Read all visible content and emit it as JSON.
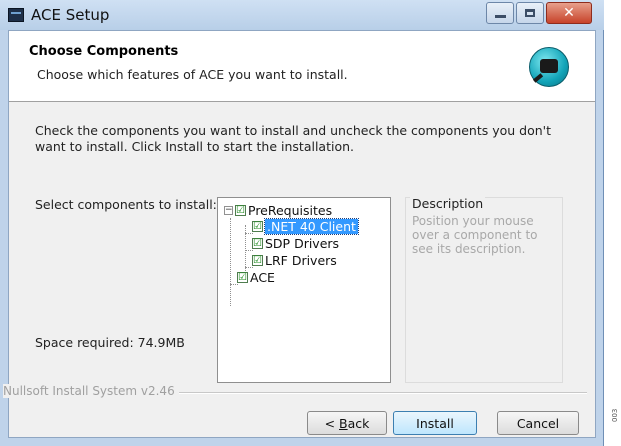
{
  "window": {
    "title": "ACE Setup",
    "close_glyph": "✕"
  },
  "header": {
    "title": "Choose Components",
    "subtitle": "Choose which features of ACE you want to install."
  },
  "main": {
    "intro": "Check the components you want to install and uncheck the components you don't want to install. Click Install to start the installation.",
    "select_label": "Select components to install:",
    "space_required": "Space required: 74.9MB",
    "tree": [
      {
        "label": "PreRequisites",
        "checked": true,
        "expander": "−"
      },
      {
        "label": ".NET 40 Client",
        "checked": true,
        "selected": true
      },
      {
        "label": "SDP Drivers",
        "checked": true
      },
      {
        "label": "LRF Drivers",
        "checked": true
      },
      {
        "label": "ACE",
        "checked": true
      }
    ],
    "check_glyph": "☑",
    "description": {
      "title": "Description",
      "text": "Position your mouse over a component to see its description."
    }
  },
  "footer": {
    "branding": "Nullsoft Install System v2.46",
    "buttons": {
      "back_prefix": "< ",
      "back_accel": "B",
      "back_rest": "ack",
      "install": "Install",
      "cancel": "Cancel"
    }
  },
  "side_mark": "003"
}
